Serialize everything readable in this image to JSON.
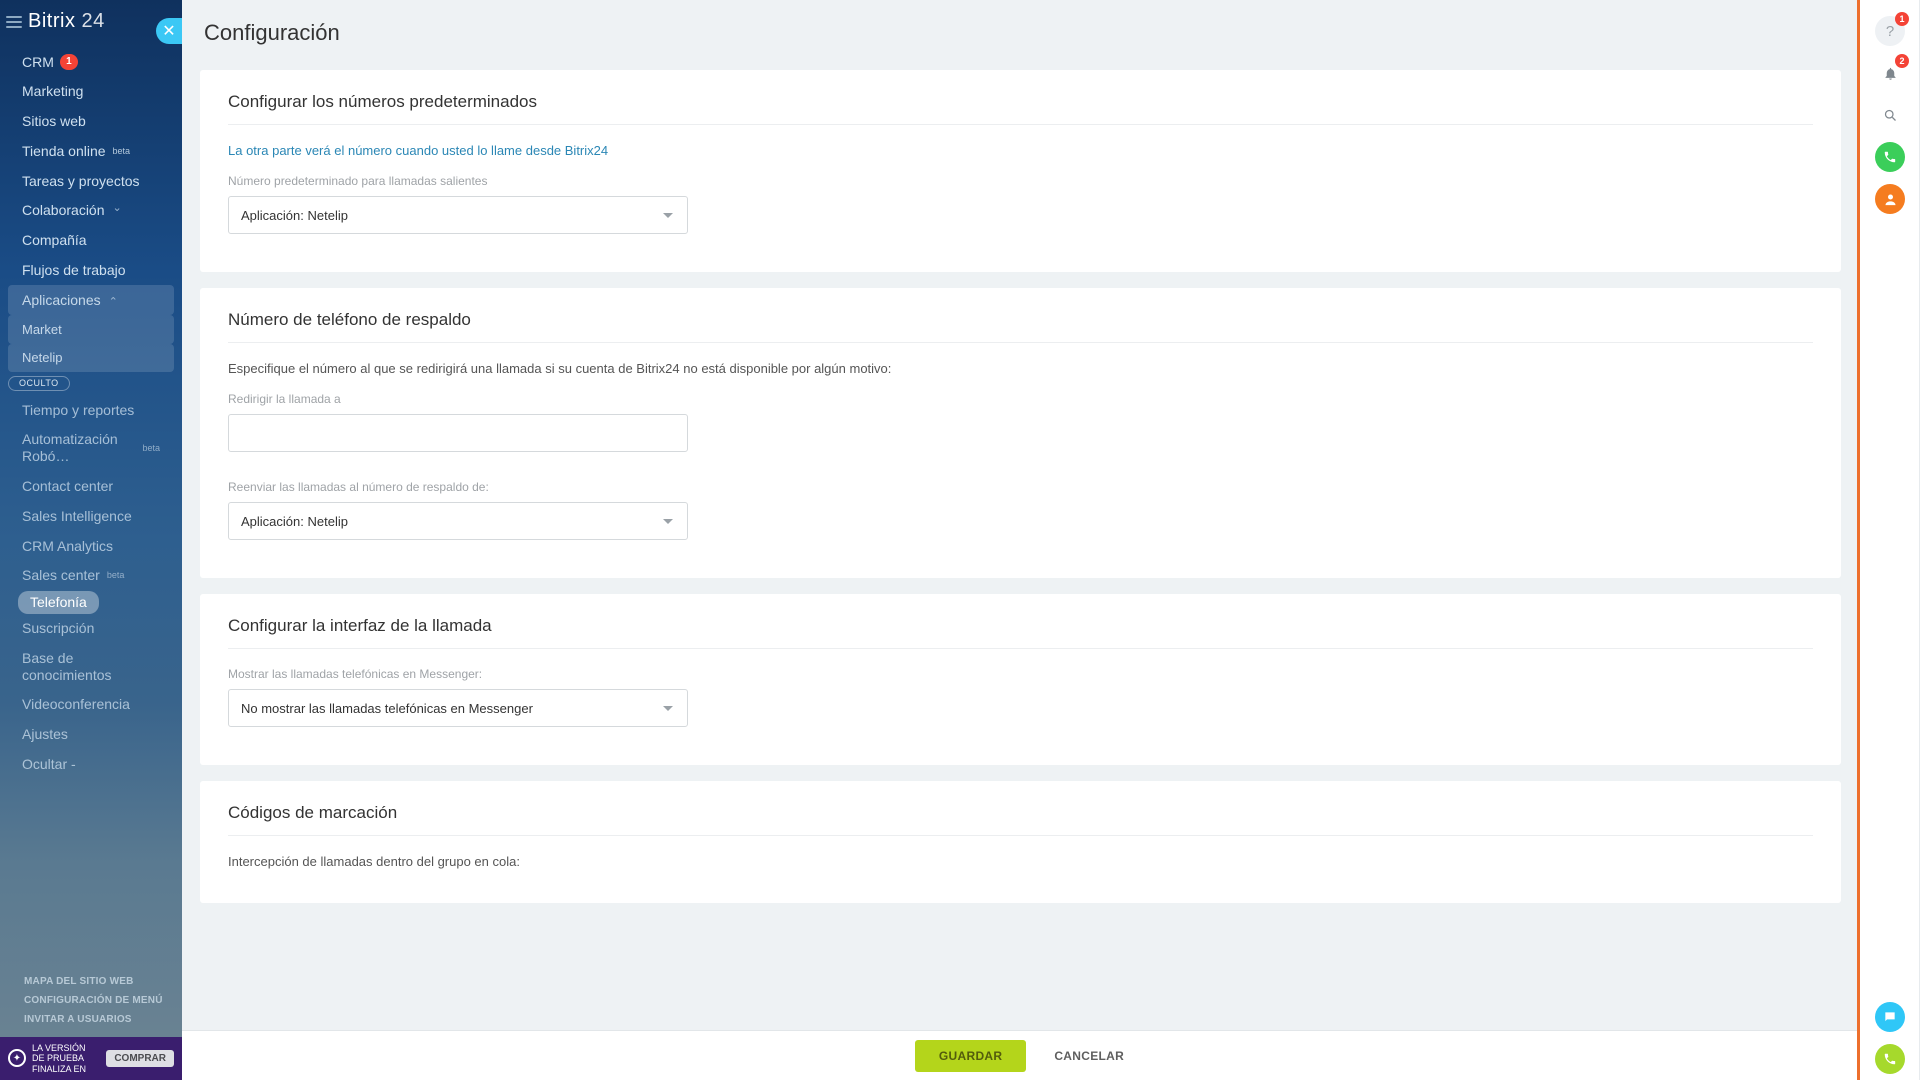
{
  "brand": {
    "name": "Bitrix",
    "suffix": "24"
  },
  "page": {
    "title": "Configuración"
  },
  "nav": {
    "crm": "CRM",
    "crm_badge": "1",
    "marketing": "Marketing",
    "sitios": "Sitios web",
    "tienda": "Tienda online",
    "tienda_sup": "beta",
    "tareas": "Tareas y proyectos",
    "colab": "Colaboración",
    "compania": "Compañía",
    "flujos": "Flujos de trabajo",
    "apps": "Aplicaciones",
    "market": "Market",
    "netelip": "Netelip",
    "oculto": "OCULTO",
    "tiempo": "Tiempo y reportes",
    "autom": "Automatización Robó…",
    "autom_sup": "beta",
    "cc": "Contact center",
    "si": "Sales Intelligence",
    "crma": "CRM Analytics",
    "sc": "Sales center",
    "sc_sup": "beta",
    "tel": "Telefonía",
    "susc": "Suscripción",
    "base": "Base de conocimientos",
    "video": "Videoconferencia",
    "ajustes": "Ajustes",
    "ocultar": "Ocultar -"
  },
  "bottom": {
    "mapa": "MAPA DEL SITIO WEB",
    "conf": "CONFIGURACIÓN DE MENÚ",
    "invitar": "INVITAR A USUARIOS"
  },
  "trial": {
    "msg": "LA VERSIÓN DE PRUEBA FINALIZA EN",
    "buy": "COMPRAR"
  },
  "section1": {
    "title": "Configurar los números predeterminados",
    "note": "La otra parte verá el número cuando usted lo llame desde Bitrix24",
    "label": "Número predeterminado para llamadas salientes",
    "value": "Aplicación: Netelip"
  },
  "section2": {
    "title": "Número de teléfono de respaldo",
    "desc": "Especifique el número al que se redirigirá una llamada si su cuenta de Bitrix24 no está disponible por algún motivo:",
    "label1": "Redirigir la llamada a",
    "label2": "Reenviar las llamadas al número de respaldo de:",
    "value2": "Aplicación: Netelip"
  },
  "section3": {
    "title": "Configurar la interfaz de la llamada",
    "label": "Mostrar las llamadas telefónicas en Messenger:",
    "value": "No mostrar las llamadas telefónicas en Messenger"
  },
  "section4": {
    "title": "Códigos de marcación",
    "desc": "Intercepción de llamadas dentro del grupo en cola:"
  },
  "footer": {
    "save": "GUARDAR",
    "cancel": "CANCELAR"
  },
  "rail": {
    "help_badge": "1",
    "bell_badge": "2"
  }
}
